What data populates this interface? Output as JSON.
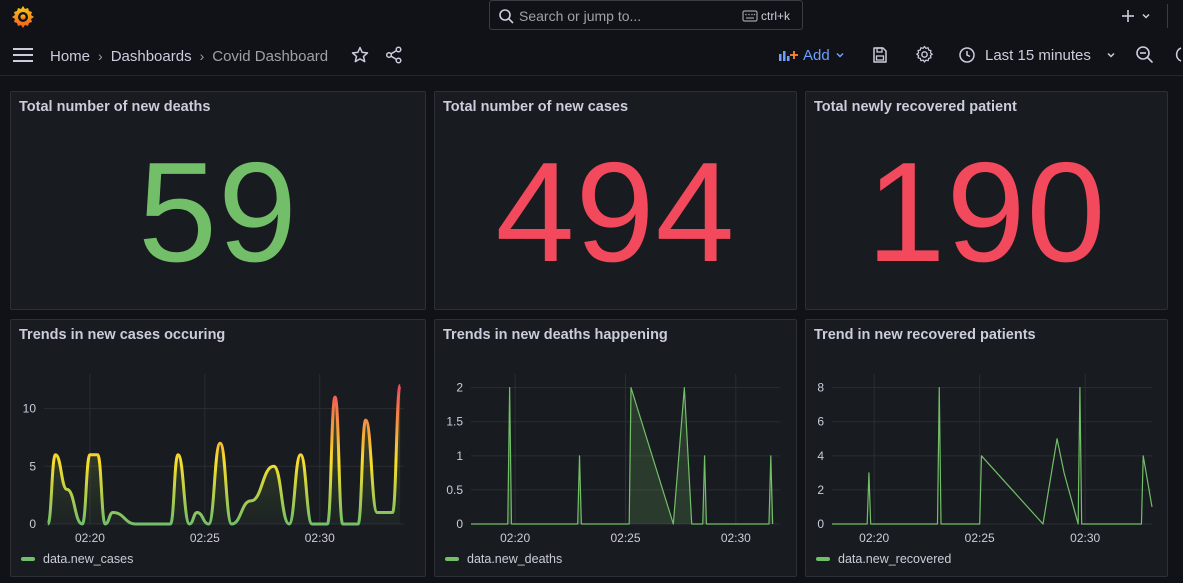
{
  "search": {
    "placeholder": "Search or jump to...",
    "shortcut": "ctrl+k"
  },
  "breadcrumb": {
    "home": "Home",
    "dashboards": "Dashboards",
    "current": "Covid Dashboard"
  },
  "toolbar": {
    "add_label": "Add",
    "time_range": "Last 15 minutes"
  },
  "colors": {
    "green": "#73bf69",
    "red": "#f2495c",
    "yellow": "#fade2a",
    "accent": "#6e9fff"
  },
  "stats": [
    {
      "title": "Total number of new deaths",
      "value": "59",
      "color": "#73bf69"
    },
    {
      "title": "Total number of new cases",
      "value": "494",
      "color": "#f2495c"
    },
    {
      "title": "Total newly recovered patient",
      "value": "190",
      "color": "#f2495c"
    }
  ],
  "charts": {
    "cases": {
      "title": "Trends in new cases occuring",
      "legend": "data.new_cases"
    },
    "deaths": {
      "title": "Trends in new deaths happening",
      "legend": "data.new_deaths"
    },
    "recovered": {
      "title": "Trend in new recovered patients",
      "legend": "data.new_recovered"
    }
  },
  "chart_data": [
    {
      "type": "line",
      "title": "Trends in new cases occuring",
      "x_ticks": [
        "02:20",
        "02:25",
        "02:30"
      ],
      "y_ticks": [
        0,
        5,
        10
      ],
      "ylim": [
        0,
        13
      ],
      "series": [
        {
          "name": "data.new_cases",
          "x": [
            "02:18:10",
            "02:18:30",
            "02:19:00",
            "02:19:40",
            "02:20:00",
            "02:20:20",
            "02:20:40",
            "02:21:00",
            "02:22:00",
            "02:23:00",
            "02:23:30",
            "02:23:50",
            "02:24:20",
            "02:24:40",
            "02:25:10",
            "02:25:40",
            "02:26:10",
            "02:27:00",
            "02:28:00",
            "02:28:40",
            "02:29:10",
            "02:29:40",
            "02:30:00",
            "02:30:20",
            "02:30:40",
            "02:31:00",
            "02:31:40",
            "02:32:00",
            "02:32:30",
            "02:33:10",
            "02:33:30"
          ],
          "values": [
            0,
            6,
            3,
            0,
            6,
            6,
            0,
            1,
            0,
            0,
            0,
            6,
            0,
            1,
            0,
            7,
            0,
            2,
            5,
            0,
            6,
            0,
            0,
            0,
            11,
            0,
            0,
            9,
            1,
            1,
            12
          ]
        }
      ],
      "grid": true,
      "gradient_fill": true
    },
    {
      "type": "line",
      "title": "Trends in new deaths happening",
      "x_ticks": [
        "02:20",
        "02:25",
        "02:30"
      ],
      "y_ticks": [
        0,
        0.5,
        1,
        1.5,
        2
      ],
      "ylim": [
        0,
        2.2
      ],
      "series": [
        {
          "name": "data.new_deaths",
          "x": [
            "02:18:00",
            "02:19:40",
            "02:19:45",
            "02:19:50",
            "02:22:50",
            "02:22:55",
            "02:23:00",
            "02:25:10",
            "02:25:15",
            "02:27:10",
            "02:27:40",
            "02:28:00",
            "02:28:30",
            "02:28:35",
            "02:28:40",
            "02:31:30",
            "02:31:35",
            "02:31:40"
          ],
          "values": [
            0,
            0,
            2,
            0,
            0,
            1,
            0,
            0,
            2,
            0,
            2,
            0,
            0,
            1,
            0,
            0,
            1,
            0
          ]
        }
      ],
      "grid": true
    },
    {
      "type": "line",
      "title": "Trend in new recovered patients",
      "x_ticks": [
        "02:20",
        "02:25",
        "02:30"
      ],
      "y_ticks": [
        0,
        2,
        4,
        6,
        8
      ],
      "ylim": [
        0,
        8.8
      ],
      "series": [
        {
          "name": "data.new_recovered",
          "x": [
            "02:18:00",
            "02:19:40",
            "02:19:45",
            "02:19:50",
            "02:23:00",
            "02:23:05",
            "02:23:10",
            "02:25:00",
            "02:25:05",
            "02:28:00",
            "02:28:40",
            "02:29:00",
            "02:29:40",
            "02:29:45",
            "02:29:50",
            "02:32:40",
            "02:32:45",
            "02:33:10"
          ],
          "values": [
            0,
            0,
            3,
            0,
            0,
            8,
            0,
            0,
            4,
            0,
            5,
            3,
            0,
            8,
            0,
            0,
            4,
            1
          ]
        }
      ],
      "grid": true
    }
  ]
}
